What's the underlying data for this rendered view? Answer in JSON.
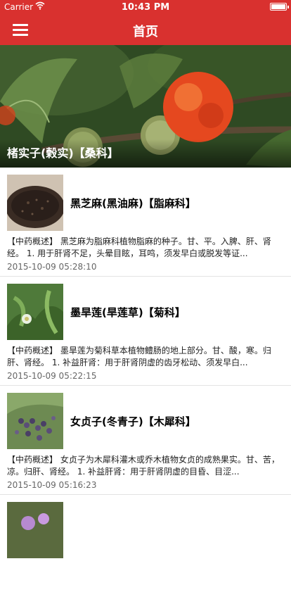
{
  "status": {
    "carrier": "Carrier",
    "time": "10:43 PM"
  },
  "nav": {
    "title": "首页"
  },
  "banner": {
    "title": "楮实子(榖实)【桑科】"
  },
  "items": [
    {
      "title": "黑芝麻(黑油麻)【脂麻科】",
      "summary": "【中药概述】 黑芝麻为脂麻科植物脂麻的种子。甘、平。入脾、肝、肾经。 1. 用于肝肾不足，头晕目眩，耳鸣，须发早白或脱发等证...",
      "date": "2015-10-09 05:28:10"
    },
    {
      "title": "墨旱莲(旱莲草)【菊科】",
      "summary": "【中药概述】 墨旱莲为菊科草本植物鳢肠的地上部分。甘、酸，寒。归肝、肾经。 1. 补益肝肾：用于肝肾阴虚的齿牙松动、须发早白...",
      "date": "2015-10-09 05:22:15"
    },
    {
      "title": "女贞子(冬青子)【木犀科】",
      "summary": "【中药概述】 女贞子为木犀科灌木或乔木植物女贞的成熟果实。甘、苦，凉。归肝、肾经。 1. 补益肝肾：用于肝肾阴虚的目昏、目涩...",
      "date": "2015-10-09 05:16:23"
    }
  ],
  "colors": {
    "accent": "#d9312f"
  },
  "icons": {
    "menu": "hamburger-menu-icon",
    "wifi": "wifi-icon",
    "battery": "battery-icon"
  }
}
